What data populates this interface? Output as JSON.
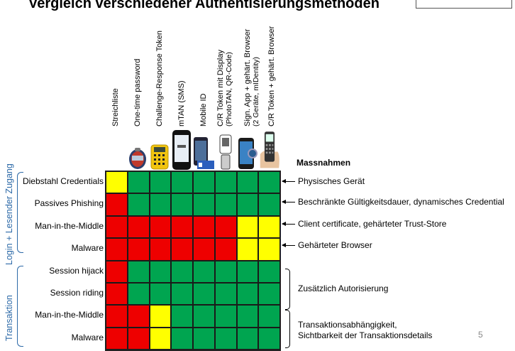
{
  "title": "Vergleich verschiedener Authentisierungsmethoden",
  "methods": [
    {
      "label": "Streichliste",
      "device": "none"
    },
    {
      "label": "One-time password",
      "device": "otp-token-icon"
    },
    {
      "label": "Challenge-Response Token",
      "device": "cr-token-icon"
    },
    {
      "label": "mTAN (SMS)",
      "device": "mobile-phone-icon"
    },
    {
      "label": "Mobile ID",
      "device": "mobile-id-icon"
    },
    {
      "label": "C/R Token mit Display",
      "label2": "(PhotoTAN, QR-Code)",
      "device": "photo-tan-icon"
    },
    {
      "label": "Sign. App + gehärt. Browser",
      "label2": "(2 Geräte, mIDentity)",
      "device": "smartphone-icon"
    },
    {
      "label": "C/R Token + gehärt. Browser",
      "device": "hand-token-icon"
    }
  ],
  "massnahmen_heading": "Massnahmen",
  "groups": [
    {
      "label": "Login + Lesender Zugang"
    },
    {
      "label": "Transaktion"
    }
  ],
  "rows": [
    {
      "label": "Diebstahl Credentials",
      "cells": [
        "Y",
        "G",
        "G",
        "G",
        "G",
        "G",
        "G",
        "G"
      ]
    },
    {
      "label": "Passives Phishing",
      "cells": [
        "R",
        "G",
        "G",
        "G",
        "G",
        "G",
        "G",
        "G"
      ]
    },
    {
      "label": "Man-in-the-Middle",
      "cells": [
        "R",
        "R",
        "R",
        "R",
        "R",
        "R",
        "Y",
        "Y"
      ]
    },
    {
      "label": "Malware",
      "cells": [
        "R",
        "R",
        "R",
        "R",
        "R",
        "R",
        "Y",
        "Y"
      ]
    },
    {
      "label": "Session hijack",
      "cells": [
        "R",
        "G",
        "G",
        "G",
        "G",
        "G",
        "G",
        "G"
      ]
    },
    {
      "label": "Session riding",
      "cells": [
        "R",
        "G",
        "G",
        "G",
        "G",
        "G",
        "G",
        "G"
      ]
    },
    {
      "label": "Man-in-the-Middle",
      "cells": [
        "R",
        "R",
        "Y",
        "G",
        "G",
        "G",
        "G",
        "G"
      ]
    },
    {
      "label": "Malware",
      "cells": [
        "R",
        "R",
        "Y",
        "G",
        "G",
        "G",
        "G",
        "G"
      ]
    }
  ],
  "measures": [
    {
      "text": "Physisches Gerät"
    },
    {
      "text": "Beschränkte Gültigkeitsdauer, dynamisches Credential"
    },
    {
      "text": "Client certificate, gehärteter Trust-Store"
    },
    {
      "text": "Gehärteter Browser"
    },
    {
      "text": "Zusätzlich Autorisierung"
    },
    {
      "text": "Transaktionsabhängigkeit,"
    },
    {
      "text": "Sichtbarkeit der Transaktionsdetails"
    }
  ],
  "colors": {
    "R": "#ee0000",
    "G": "#00a550",
    "Y": "#ffff00",
    "accent": "#2d6aa8"
  },
  "page_number": "5"
}
